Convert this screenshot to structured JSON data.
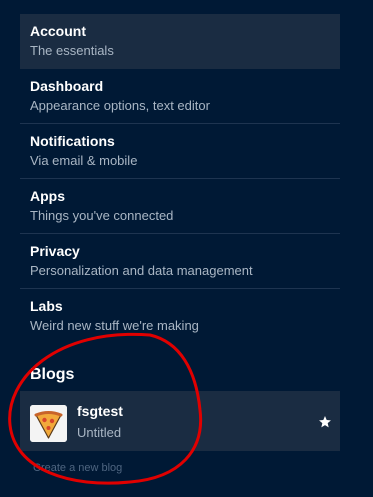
{
  "settings_nav": {
    "items": [
      {
        "title": "Account",
        "subtitle": "The essentials"
      },
      {
        "title": "Dashboard",
        "subtitle": "Appearance options, text editor"
      },
      {
        "title": "Notifications",
        "subtitle": "Via email & mobile"
      },
      {
        "title": "Apps",
        "subtitle": "Things you've connected"
      },
      {
        "title": "Privacy",
        "subtitle": "Personalization and data management"
      },
      {
        "title": "Labs",
        "subtitle": "Weird new stuff we're making"
      }
    ],
    "active_item": "Account"
  },
  "blogs": {
    "heading": "Blogs",
    "items": [
      {
        "name": "fsgtest",
        "title": "Untitled",
        "avatar_icon": "pizza-slice-icon",
        "primary": true
      }
    ],
    "create_link": "Create a new blog"
  },
  "colors": {
    "background": "#001935",
    "active_row": "#1a2c42",
    "annotation": "#e00000"
  }
}
